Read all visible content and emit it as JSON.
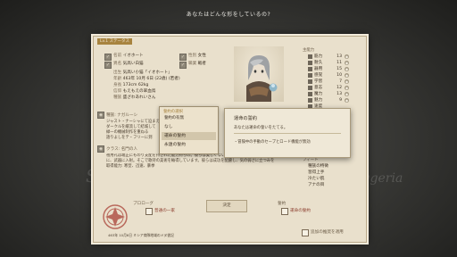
{
  "prompt": "あなたはどんな形をしているの?",
  "background_text": {
    "left": "Sout",
    "right": "Sggeria"
  },
  "panel": {
    "tab_title": "Lv.1  ステータス"
  },
  "profile": [
    {
      "label": "名前",
      "value": "イオホート"
    },
    {
      "label": "異名",
      "value": "気高い白猫"
    },
    {
      "label": "出生",
      "value": "気高い小猫「イオホート」"
    },
    {
      "label": "年齢",
      "value": "463年 10月 6日 (22歳) (若者)"
    },
    {
      "label": "身長",
      "value": "173cm 62kg"
    },
    {
      "label": "信仰",
      "value": "もえもえの翠血鳥"
    },
    {
      "label": "種族",
      "value": "盛ざわあれいさん"
    }
  ],
  "profile_right": [
    {
      "label": "性別",
      "value": "女性"
    },
    {
      "label": "職業",
      "value": "戦者"
    }
  ],
  "stats_header": "主能力",
  "stats": [
    {
      "name": "筋力",
      "value": "13"
    },
    {
      "name": "耐久",
      "value": "11"
    },
    {
      "name": "器用",
      "value": "15"
    },
    {
      "name": "感覚",
      "value": "10"
    },
    {
      "name": "学習",
      "value": "7"
    },
    {
      "name": "意志",
      "value": "12"
    },
    {
      "name": "魔力",
      "value": "13"
    },
    {
      "name": "魅力",
      "value": "9"
    },
    {
      "name": "速度",
      "value": ""
    }
  ],
  "skills_header": "スキル",
  "skills": [
    "",
    "",
    "",
    ""
  ],
  "secondary_header": "フィート",
  "secondary": [
    {
      "name": "種族の特徴",
      "value": ""
    },
    {
      "name": "習得上手",
      "value": ""
    },
    {
      "name": "冷たい肌",
      "value": ""
    },
    {
      "name": "アナの目",
      "value": ""
    }
  ],
  "trait_section": {
    "label": "種族: ナガルーシ",
    "lines": [
      "ジャスト・ナーシャにて迫まえばいつでも",
      "ダークルを緩流して結城して",
      "緑一の機械制作を重ねる",
      "語りよしをテ・フリーに到"
    ]
  },
  "class_section": {
    "label": "クラス: 名門の人",
    "lines": [
      "祖用礼は端正にものり支配を持された能力持ちの。彼らは美しくない不法を執行するため",
      "に、武器に入射。そこで歌持の美術を輸得しています。彼らは成功を配慮し、気の弱さに立つみを",
      "取得能力: 寒型、迅速、暴挙"
    ]
  },
  "dropdown": {
    "header": "誓約の選択",
    "subheader": "誓約の有無",
    "items": [
      "なし",
      "運命の誓約",
      "永遠の誓約"
    ],
    "selected_index": 1
  },
  "tooltip": {
    "title": "運命の誓約",
    "description": "あなたは運命の誓いをたてる。",
    "bullet": "・冒険中の手動のセーブとロード機能が無効"
  },
  "bottom": {
    "prologue_label": "プロローグ",
    "prologue_value": "普通の一家",
    "confirm_label": "決定",
    "oath_label": "誓約",
    "oath_value": "運命の誓約",
    "footer_text": "463年 10月6日 ミシア商隊地域のメヌ書記",
    "checkbox_label": "追加の推奨を適用"
  },
  "colors": {
    "panel_bg": "#e9e0cc",
    "accent": "#a7833f",
    "crest": "#b9695c"
  }
}
